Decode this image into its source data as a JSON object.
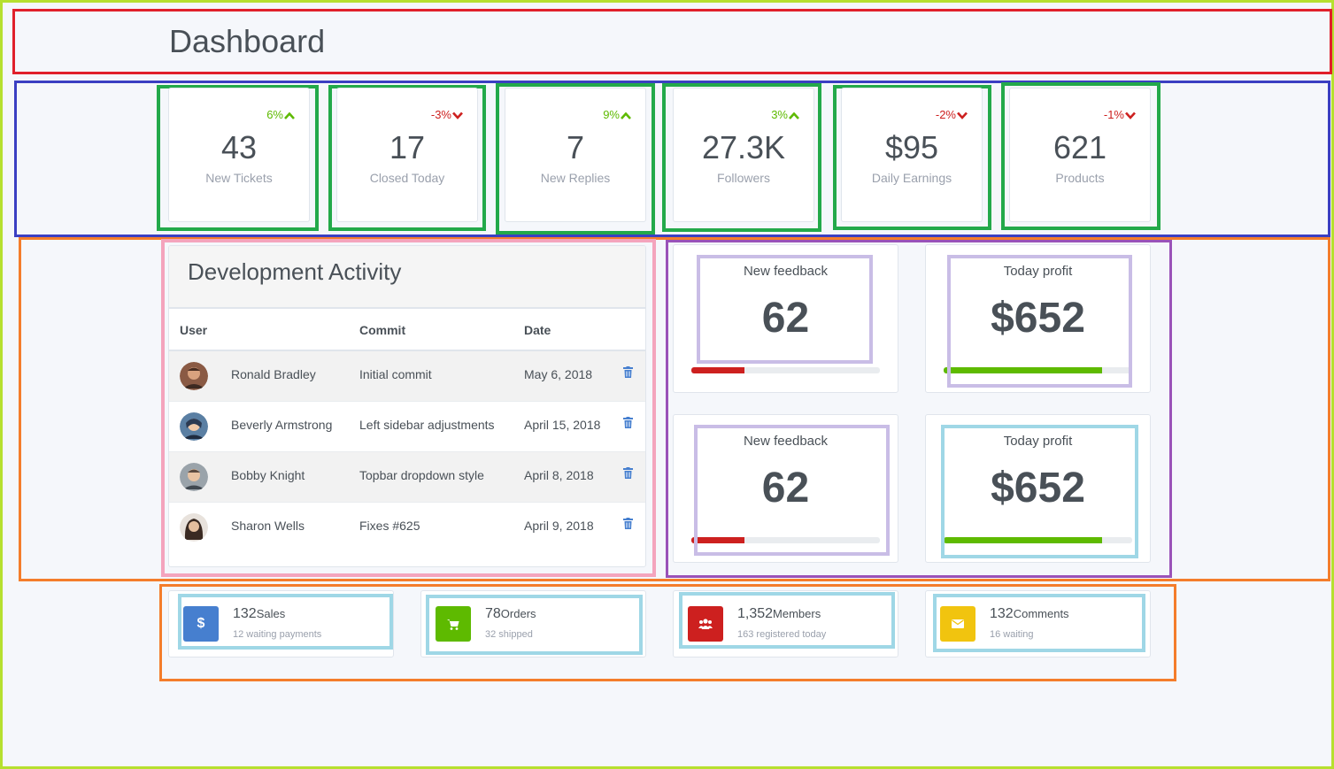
{
  "header": {
    "title": "Dashboard"
  },
  "stats": [
    {
      "change": "6%",
      "direction": "up",
      "value": "43",
      "label": "New Tickets"
    },
    {
      "change": "-3%",
      "direction": "down",
      "value": "17",
      "label": "Closed Today"
    },
    {
      "change": "9%",
      "direction": "up",
      "value": "7",
      "label": "New Replies"
    },
    {
      "change": "3%",
      "direction": "up",
      "value": "27.3K",
      "label": "Followers"
    },
    {
      "change": "-2%",
      "direction": "down",
      "value": "$95",
      "label": "Daily Earnings"
    },
    {
      "change": "-1%",
      "direction": "down",
      "value": "621",
      "label": "Products"
    }
  ],
  "activity": {
    "title": "Development Activity",
    "columns": [
      "User",
      "Commit",
      "Date"
    ],
    "rows": [
      {
        "user": "Ronald Bradley",
        "commit": "Initial commit",
        "date": "May 6, 2018"
      },
      {
        "user": "Beverly Armstrong",
        "commit": "Left sidebar adjustments",
        "date": "April 15, 2018"
      },
      {
        "user": "Bobby Knight",
        "commit": "Topbar dropdown style",
        "date": "April 8, 2018"
      },
      {
        "user": "Sharon Wells",
        "commit": "Fixes #625",
        "date": "April 9, 2018"
      }
    ],
    "delete_icon": "trash-icon"
  },
  "widgets": [
    {
      "title": "New feedback",
      "value": "62",
      "progress": 0.28,
      "color": "#cd201f"
    },
    {
      "title": "Today profit",
      "value": "$652",
      "progress": 0.84,
      "color": "#5eba00"
    },
    {
      "title": "New feedback",
      "value": "62",
      "progress": 0.28,
      "color": "#cd201f"
    },
    {
      "title": "Today profit",
      "value": "$652",
      "progress": 0.84,
      "color": "#5eba00"
    }
  ],
  "summary": [
    {
      "icon": "dollar-icon",
      "color": "#467fcf",
      "value": "132",
      "unit": "Sales",
      "sub": "12 waiting payments"
    },
    {
      "icon": "cart-icon",
      "color": "#5eba00",
      "value": "78",
      "unit": "Orders",
      "sub": "32 shipped"
    },
    {
      "icon": "users-icon",
      "color": "#cd201f",
      "value": "1,352",
      "unit": "Members",
      "sub": "163 registered today"
    },
    {
      "icon": "mail-icon",
      "color": "#f1c40f",
      "value": "132",
      "unit": "Comments",
      "sub": "16 waiting"
    }
  ],
  "colors": {
    "up": "#5eba00",
    "down": "#cd201f",
    "page_bg": "#f5f7fb"
  }
}
